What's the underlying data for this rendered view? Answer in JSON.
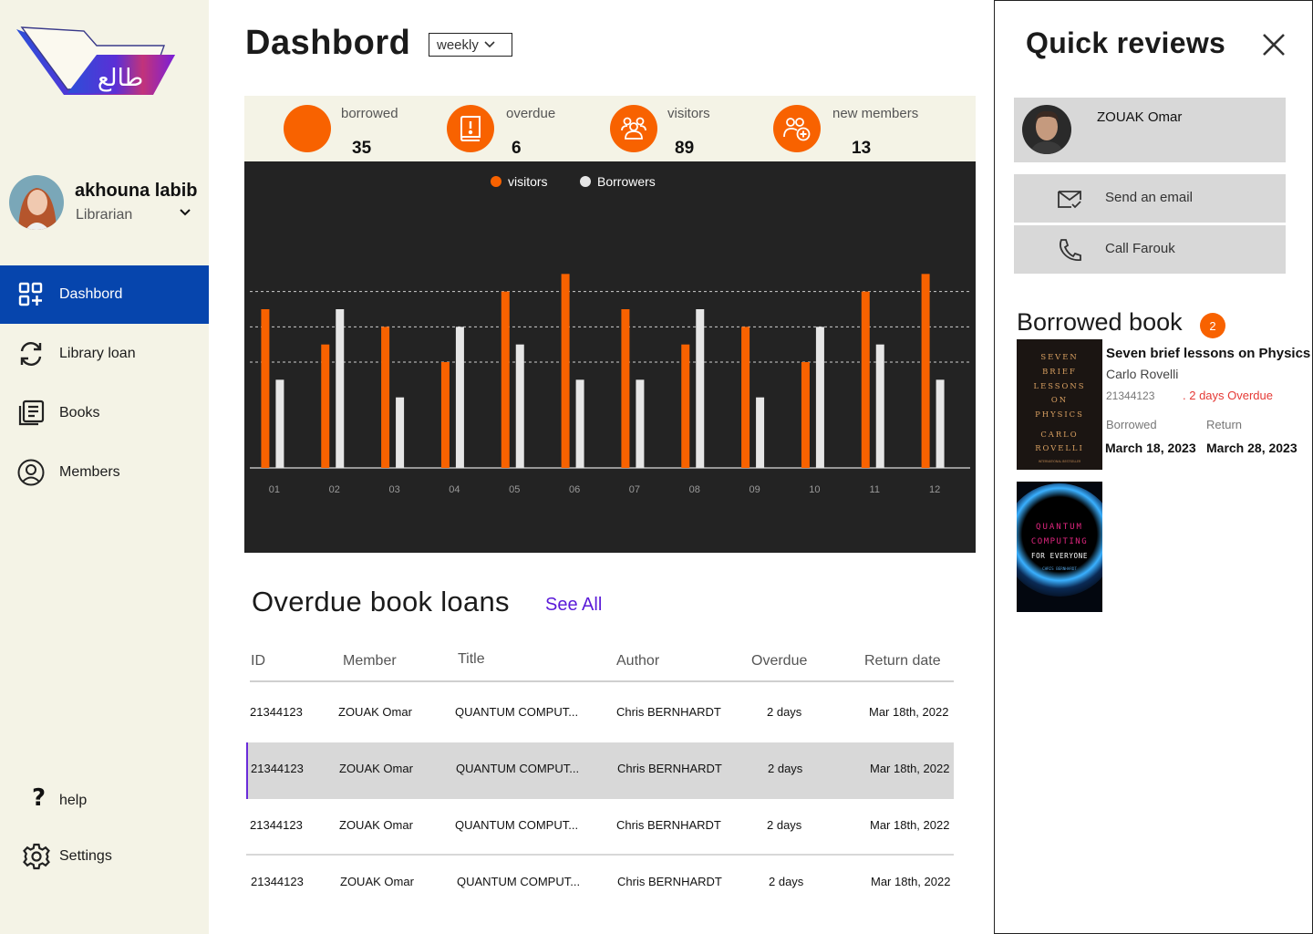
{
  "sidebar": {
    "logo_text": "طالع",
    "user": {
      "name": "akhouna labib",
      "role": "Librarian"
    },
    "nav": [
      {
        "label": "Dashbord",
        "icon": "dashboard-grid-icon",
        "active": true
      },
      {
        "label": "Library loan",
        "icon": "refresh-icon"
      },
      {
        "label": "Books",
        "icon": "books-icon"
      },
      {
        "label": "Members",
        "icon": "user-circle-icon"
      }
    ],
    "help_label": "help",
    "help_icon": "question-mark-icon",
    "settings_label": "Settings",
    "settings_icon": "gear-icon"
  },
  "header": {
    "title": "Dashbord",
    "period": "weekly"
  },
  "stats": [
    {
      "label": "borrowed",
      "value": "35",
      "icon": "none"
    },
    {
      "label": "overdue",
      "value": "6",
      "icon": "book-alert-icon"
    },
    {
      "label": "visitors",
      "value": "89",
      "icon": "group-icon"
    },
    {
      "label": "new members",
      "value": "13",
      "icon": "add-user-icon"
    }
  ],
  "chart_data": {
    "type": "bar",
    "categories": [
      "01",
      "02",
      "03",
      "04",
      "05",
      "06",
      "07",
      "08",
      "09",
      "10",
      "11",
      "12"
    ],
    "series": [
      {
        "name": "visitors",
        "color": "#f86200",
        "values": [
          9,
          7,
          8,
          6,
          10,
          11,
          9,
          7,
          8,
          6,
          10,
          11
        ]
      },
      {
        "name": "Borrowers",
        "color": "#e6e6e6",
        "values": [
          5,
          9,
          4,
          8,
          7,
          5,
          5,
          9,
          4,
          8,
          7,
          5
        ]
      }
    ],
    "ylim": [
      0,
      12
    ],
    "grid": true,
    "legend": "top-center",
    "colors": {
      "background": "#232323",
      "grid": "#cfcfcf",
      "axis": "#bdbdbd"
    }
  },
  "overdue": {
    "title": "Overdue book loans",
    "see_all": "See All",
    "columns": [
      "ID",
      "Member",
      "Title",
      "Author",
      "Overdue",
      "Return date"
    ],
    "rows": [
      [
        "21344123",
        "ZOUAK Omar",
        "QUANTUM COMPUT...",
        "Chris BERNHARDT",
        "2 days",
        "Mar 18th, 2022"
      ],
      [
        "21344123",
        "ZOUAK Omar",
        "QUANTUM COMPUT...",
        "Chris BERNHARDT",
        "2 days",
        "Mar 18th, 2022"
      ],
      [
        "21344123",
        "ZOUAK Omar",
        "QUANTUM COMPUT...",
        "Chris BERNHARDT",
        "2 days",
        "Mar 18th, 2022"
      ],
      [
        "21344123",
        "ZOUAK Omar",
        "QUANTUM COMPUT...",
        "Chris BERNHARDT",
        "2 days",
        "Mar 18th, 2022"
      ]
    ]
  },
  "panel": {
    "title": "Quick reviews",
    "member_name": "ZOUAK Omar",
    "actions": [
      {
        "label": "Send an email",
        "icon": "mail-check-icon"
      },
      {
        "label": "Call Farouk",
        "icon": "phone-icon"
      }
    ],
    "borrowed_title": "Borrowed book",
    "borrowed_count": "2",
    "book": {
      "title": "Seven brief lessons on Physics",
      "author": "Carlo Rovelli",
      "id": "21344123",
      "overdue": ". 2 days Overdue",
      "borrowed_label": "Borrowed",
      "return_label": "Return",
      "borrowed_date": "March 18, 2023",
      "return_date": "March 28, 2023"
    },
    "cover1": {
      "lines": [
        "SEVEN",
        "BRIEF",
        "LESSONS",
        "ON",
        "PHYSICS",
        "CARLO",
        "ROVELLI"
      ],
      "tagline": "INTERNATIONAL BESTSELLER"
    },
    "cover2": {
      "lines": [
        "QUANTUM",
        "COMPUTING",
        "FOR EVERYONE"
      ],
      "author": "CHRIS BERNHARDT"
    }
  },
  "colors": {
    "accent": "#f86200",
    "nav_active": "#0645ad",
    "link": "#5b1bd8",
    "sidebar_bg": "#f4f3e6"
  }
}
